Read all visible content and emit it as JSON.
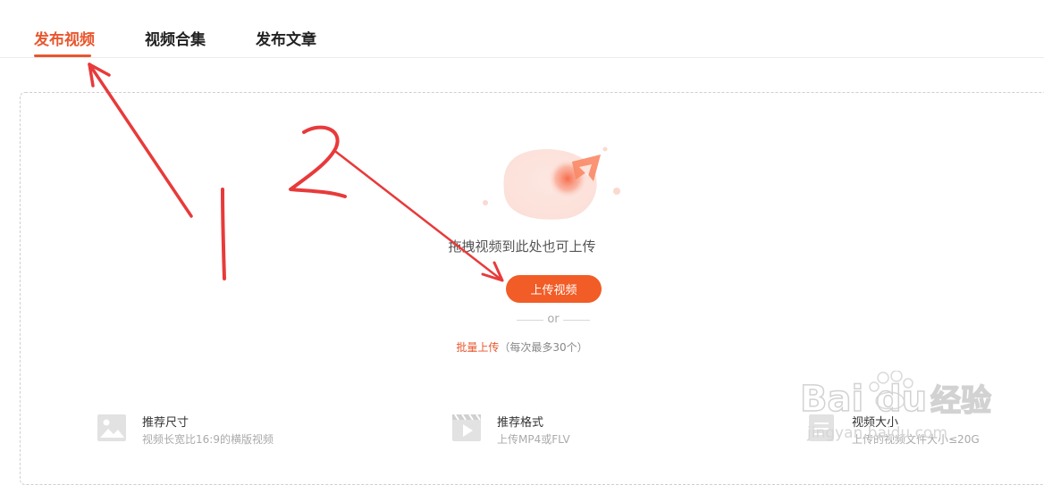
{
  "tabs": [
    {
      "label": "发布视频",
      "active": true
    },
    {
      "label": "视频合集",
      "active": false
    },
    {
      "label": "发布文章",
      "active": false
    }
  ],
  "upload": {
    "hint": "拖拽视频到此处也可上传",
    "button_label": "上传视频",
    "or_text": "or",
    "batch_link": "批量上传",
    "batch_note": "（每次最多30个）"
  },
  "specs": [
    {
      "icon": "image-icon",
      "title": "推荐尺寸",
      "desc": "视频长宽比16:9的横版视频"
    },
    {
      "icon": "video-file-icon",
      "title": "推荐格式",
      "desc": "上传MP4或FLV"
    },
    {
      "icon": "file-size-icon",
      "title": "视频大小",
      "desc": "上传的视频文件大小≤20G"
    }
  ],
  "annotations": {
    "labels": [
      "1",
      "2"
    ],
    "color": "#e83a3a"
  },
  "watermark": {
    "brand": "Baidu经验",
    "url": "jingyan.baidu.com"
  },
  "colors": {
    "accent": "#e8572f",
    "button": "#f25c26"
  }
}
